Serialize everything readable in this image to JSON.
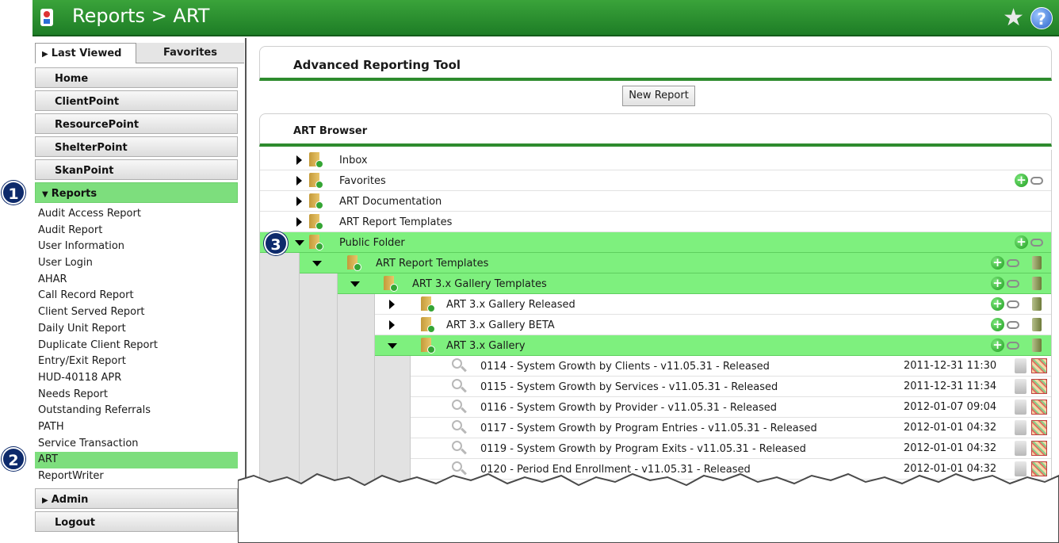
{
  "header": {
    "title": "Reports > ART",
    "star_icon": "star-icon",
    "help_label": "?"
  },
  "sidebar": {
    "tabs": [
      {
        "label": "Last Viewed",
        "active": true
      },
      {
        "label": "Favorites",
        "active": false
      }
    ],
    "nav": [
      {
        "label": "Home"
      },
      {
        "label": "ClientPoint"
      },
      {
        "label": "ResourcePoint"
      },
      {
        "label": "ShelterPoint"
      },
      {
        "label": "SkanPoint"
      }
    ],
    "reports_label": "Reports",
    "report_items": [
      "Audit Access Report",
      "Audit Report",
      "User Information",
      "User Login",
      "AHAR",
      "Call Record Report",
      "Client Served Report",
      "Daily Unit Report",
      "Duplicate Client Report",
      "Entry/Exit Report",
      "HUD-40118 APR",
      "Needs Report",
      "Outstanding Referrals",
      "PATH",
      "Service Transaction",
      "ART",
      "ReportWriter"
    ],
    "selected_item": "ART",
    "admin_label": "Admin",
    "logout_label": "Logout"
  },
  "badges": [
    "1",
    "2",
    "3"
  ],
  "main": {
    "title": "Advanced Reporting Tool",
    "new_report_label": "New Report",
    "browser_title": "ART Browser",
    "tree": [
      {
        "label": "Inbox",
        "level": 0,
        "expanded": false,
        "highlighted": false
      },
      {
        "label": "Favorites",
        "level": 0,
        "expanded": false,
        "highlighted": false
      },
      {
        "label": "ART Documentation",
        "level": 0,
        "expanded": false,
        "highlighted": false
      },
      {
        "label": "ART Report Templates",
        "level": 0,
        "expanded": false,
        "highlighted": false
      },
      {
        "label": "Public Folder",
        "level": 0,
        "expanded": true,
        "highlighted": true
      },
      {
        "label": "ART Report Templates",
        "level": 1,
        "expanded": true,
        "highlighted": true
      },
      {
        "label": "ART 3.x Gallery Templates",
        "level": 2,
        "expanded": true,
        "highlighted": true
      },
      {
        "label": "ART 3.x Gallery Released",
        "level": 3,
        "expanded": false,
        "highlighted": false
      },
      {
        "label": "ART 3.x Gallery BETA",
        "level": 3,
        "expanded": false,
        "highlighted": false
      },
      {
        "label": "ART 3.x Gallery",
        "level": 3,
        "expanded": true,
        "highlighted": true
      }
    ],
    "reports": [
      {
        "name": "0114 - System Growth by Clients - v11.05.31 - Released",
        "date": "2011-12-31 11:30"
      },
      {
        "name": "0115 - System Growth by Services - v11.05.31 - Released",
        "date": "2011-12-31 11:34"
      },
      {
        "name": "0116 - System Growth by Provider - v11.05.31 - Released",
        "date": "2012-01-07 09:04"
      },
      {
        "name": "0117 - System Growth by Program Entries - v11.05.31 - Released",
        "date": "2012-01-01 04:32"
      },
      {
        "name": "0119 - System Growth by Program Exits - v11.05.31 - Released",
        "date": "2012-01-01 04:32"
      },
      {
        "name": "0120 - Period End Enrollment - v11.05.31 - Released",
        "date": "2012-01-01 04:32"
      }
    ]
  },
  "colors": {
    "header_green": "#2a8f2e",
    "highlight_green": "#7ef07e",
    "badge_navy": "#0d2a6b"
  }
}
